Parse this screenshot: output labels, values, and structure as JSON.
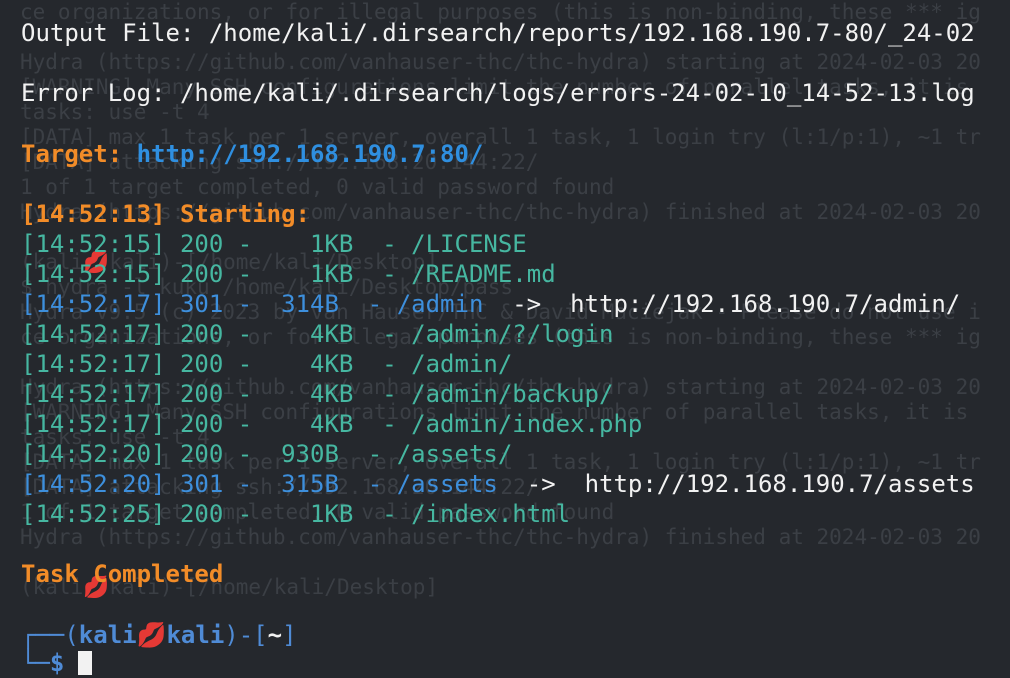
{
  "background_ghost": [
    "ce organizations, or for illegal purposes (this is non-binding, these *** ig",
    "",
    "Hydra (https://github.com/vanhauser-thc/thc-hydra) starting at 2024-02-03 20",
    "[WARNING] Many SSH configurations limit the number of parallel tasks, it is ",
    "tasks: use -t 4",
    "[DATA] max 1 task per 1 server, overall 1 task, 1 login try (l:1/p:1), ~1 tr",
    "[DATA] attacking ssh://192.168.20.144:22/",
    "1 of 1 target completed, 0 valid password found",
    "Hydra (https://github.com/vanhauser-thc/thc-hydra) finished at 2024-02-03 20",
    "",
    "(kali💋kali)-[/home/kali/Desktop]",
    "$ hydra -l kuku /home/kali/Desktop/pass",
    "Hydra v9.5 (c) 2023 by van Hauser/THC & David Maciejak - Please do not use i",
    "ce organizations, or for illegal purposes (this is non-binding, these *** ig",
    "",
    "Hydra (https://github.com/vanhauser-thc/thc-hydra) starting at 2024-02-03 20",
    "[WARNING] Many SSH configurations limit the number of parallel tasks, it is ",
    "tasks: use -t 4",
    "[DATA] max 1 task per 1 server, overall 1 task, 1 login try (l:1/p:1), ~1 tr",
    "[DATA] attacking ssh://192.168.20.144:22/",
    "1 of 1 target completed, 0 valid password found",
    "Hydra (https://github.com/vanhauser-thc/thc-hydra) finished at 2024-02-03 20",
    "",
    "(kali💋kali)-[/home/kali/Desktop]"
  ],
  "header": {
    "output_label": "Output File: ",
    "output_path": "/home/kali/.dirsearch/reports/192.168.190.7-80/_24-02",
    "error_label": "Error Log: ",
    "error_path": "/home/kali/.dirsearch/logs/errors-24-02-10_14-52-13.log",
    "target_label": "Target: ",
    "target_url": "http://192.168.190.7:80/"
  },
  "start": {
    "time": "[14:52:13]",
    "label": " Starting:"
  },
  "results": [
    {
      "time": "[14:52:15]",
      "code": "200",
      "size": "  1KB",
      "path": "/LICENSE",
      "redirect": ""
    },
    {
      "time": "[14:52:15]",
      "code": "200",
      "size": "  1KB",
      "path": "/README.md",
      "redirect": ""
    },
    {
      "time": "[14:52:17]",
      "code": "301",
      "size": "314B",
      "path": "/admin",
      "redirect": "http://192.168.190.7/admin/"
    },
    {
      "time": "[14:52:17]",
      "code": "200",
      "size": "  4KB",
      "path": "/admin/?/login",
      "redirect": ""
    },
    {
      "time": "[14:52:17]",
      "code": "200",
      "size": "  4KB",
      "path": "/admin/",
      "redirect": ""
    },
    {
      "time": "[14:52:17]",
      "code": "200",
      "size": "  4KB",
      "path": "/admin/backup/",
      "redirect": ""
    },
    {
      "time": "[14:52:17]",
      "code": "200",
      "size": "  4KB",
      "path": "/admin/index.php",
      "redirect": ""
    },
    {
      "time": "[14:52:20]",
      "code": "200",
      "size": "930B",
      "path": "/assets/",
      "redirect": ""
    },
    {
      "time": "[14:52:20]",
      "code": "301",
      "size": "315B",
      "path": "/assets",
      "redirect": "http://192.168.190.7/assets"
    },
    {
      "time": "[14:52:25]",
      "code": "200",
      "size": "  1KB",
      "path": "/index.html",
      "redirect": ""
    }
  ],
  "task_completed": "Task Completed",
  "prompt": {
    "user": "kali",
    "host": "kali",
    "skull": "💋",
    "dir": "~",
    "symbol": "$"
  },
  "colors": {
    "background": "#25282d",
    "text": "#f2f2f2",
    "orange": "#f28c28",
    "ok_green": "#46b7a1",
    "redirect_blue": "#3d8fdc"
  }
}
